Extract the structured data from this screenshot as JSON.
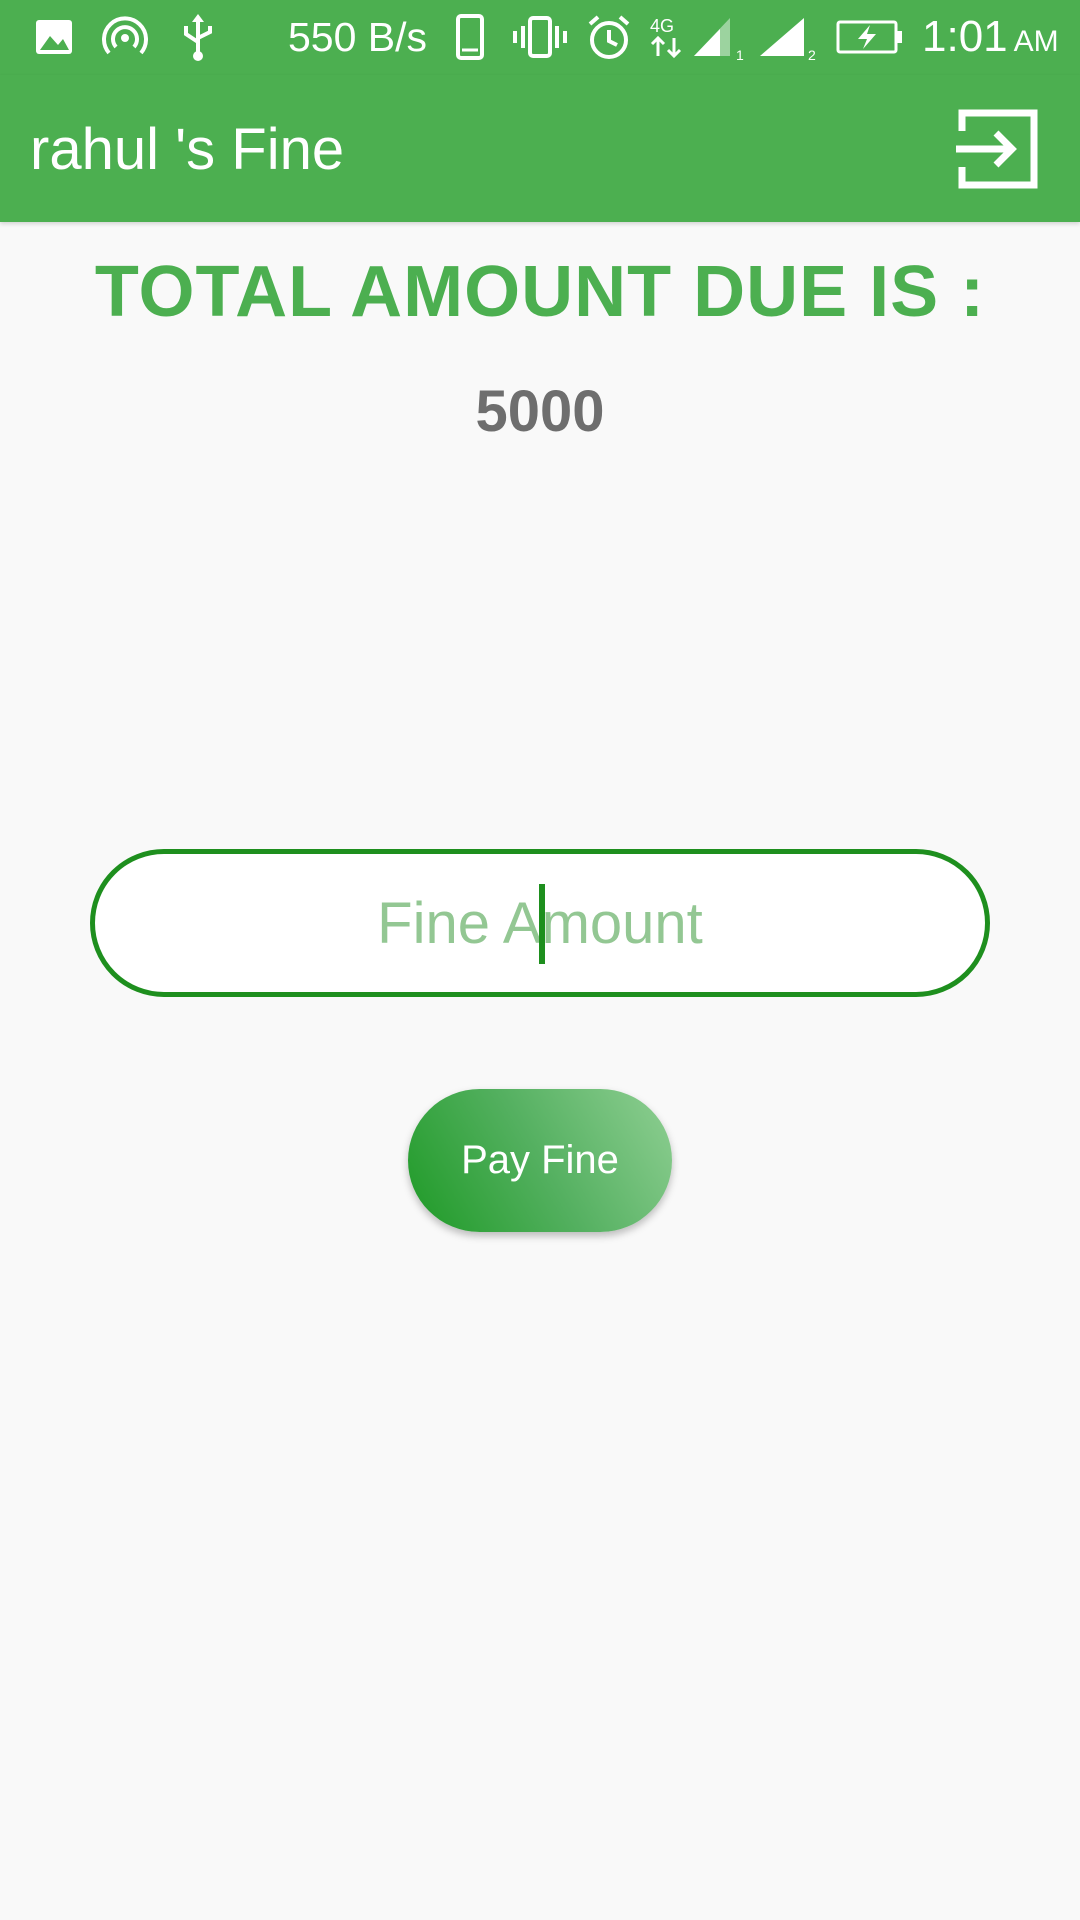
{
  "status_bar": {
    "network_speed": "550 B/s",
    "time": "1:01",
    "ampm": "AM",
    "icons": [
      "image-icon",
      "hotspot-icon",
      "usb-icon",
      "phone-icon",
      "vibrate-icon",
      "alarm-icon",
      "network-4g-icon",
      "signal-sim1-icon",
      "signal-sim2-icon",
      "battery-charging-icon"
    ],
    "sim1_label": "1",
    "sim2_label": "2",
    "network_type": "4G"
  },
  "app_bar": {
    "title": "rahul 's Fine",
    "action_icon": "logout-icon"
  },
  "main": {
    "due_label": "TOTAL AMOUNT DUE IS :",
    "due_amount": "5000",
    "fine_input": {
      "placeholder": "Fine Amount",
      "value": ""
    },
    "pay_button_label": "Pay Fine"
  },
  "colors": {
    "primary": "#4caf50",
    "accent_dark": "#1e8f1e",
    "amount_text": "#6e6e6e",
    "placeholder": "#93c793",
    "background": "#f9f9f9"
  }
}
